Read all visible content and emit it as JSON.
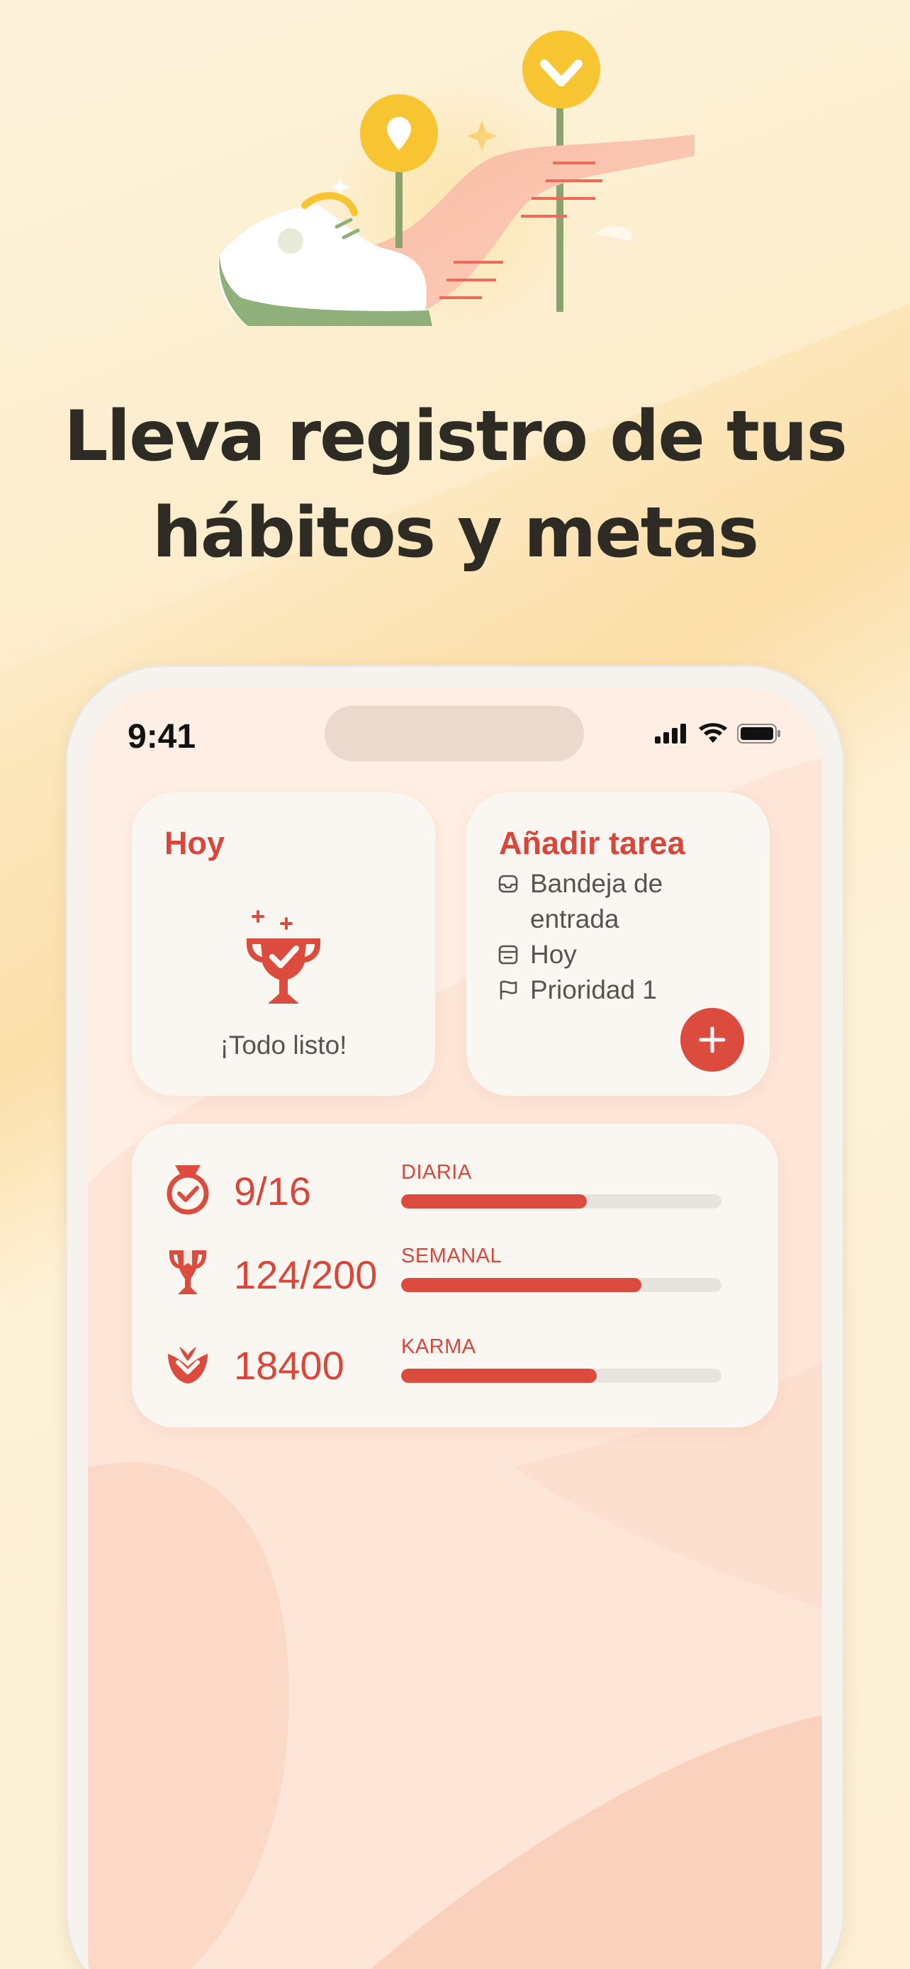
{
  "headline": {
    "line1": "Lleva registro de tus",
    "line2": "hábitos y metas"
  },
  "status_bar": {
    "time": "9:41"
  },
  "widget_today": {
    "title": "Hoy",
    "message": "¡Todo listo!",
    "icon": "trophy-check-icon"
  },
  "widget_add_task": {
    "title": "Añadir tarea",
    "items": [
      {
        "icon": "inbox-icon",
        "label": "Bandeja de entrada"
      },
      {
        "icon": "calendar-icon",
        "label": "Hoy"
      },
      {
        "icon": "flag-icon",
        "label": "Prioridad 1"
      }
    ],
    "add_icon": "plus-icon"
  },
  "widget_stats": {
    "rows": [
      {
        "icon": "medal-check-icon",
        "value": "9/16",
        "label": "DIARIA",
        "progress": 0.58
      },
      {
        "icon": "trophy-icon",
        "value": "124/200",
        "label": "SEMANAL",
        "progress": 0.75
      },
      {
        "icon": "karma-icon",
        "value": "18400",
        "label": "KARMA",
        "progress": 0.61
      }
    ]
  },
  "colors": {
    "accent": "#dc4c3e",
    "text_dark": "#2e2a24",
    "text_muted": "#5a524c",
    "bar_track": "#e7e3df"
  }
}
